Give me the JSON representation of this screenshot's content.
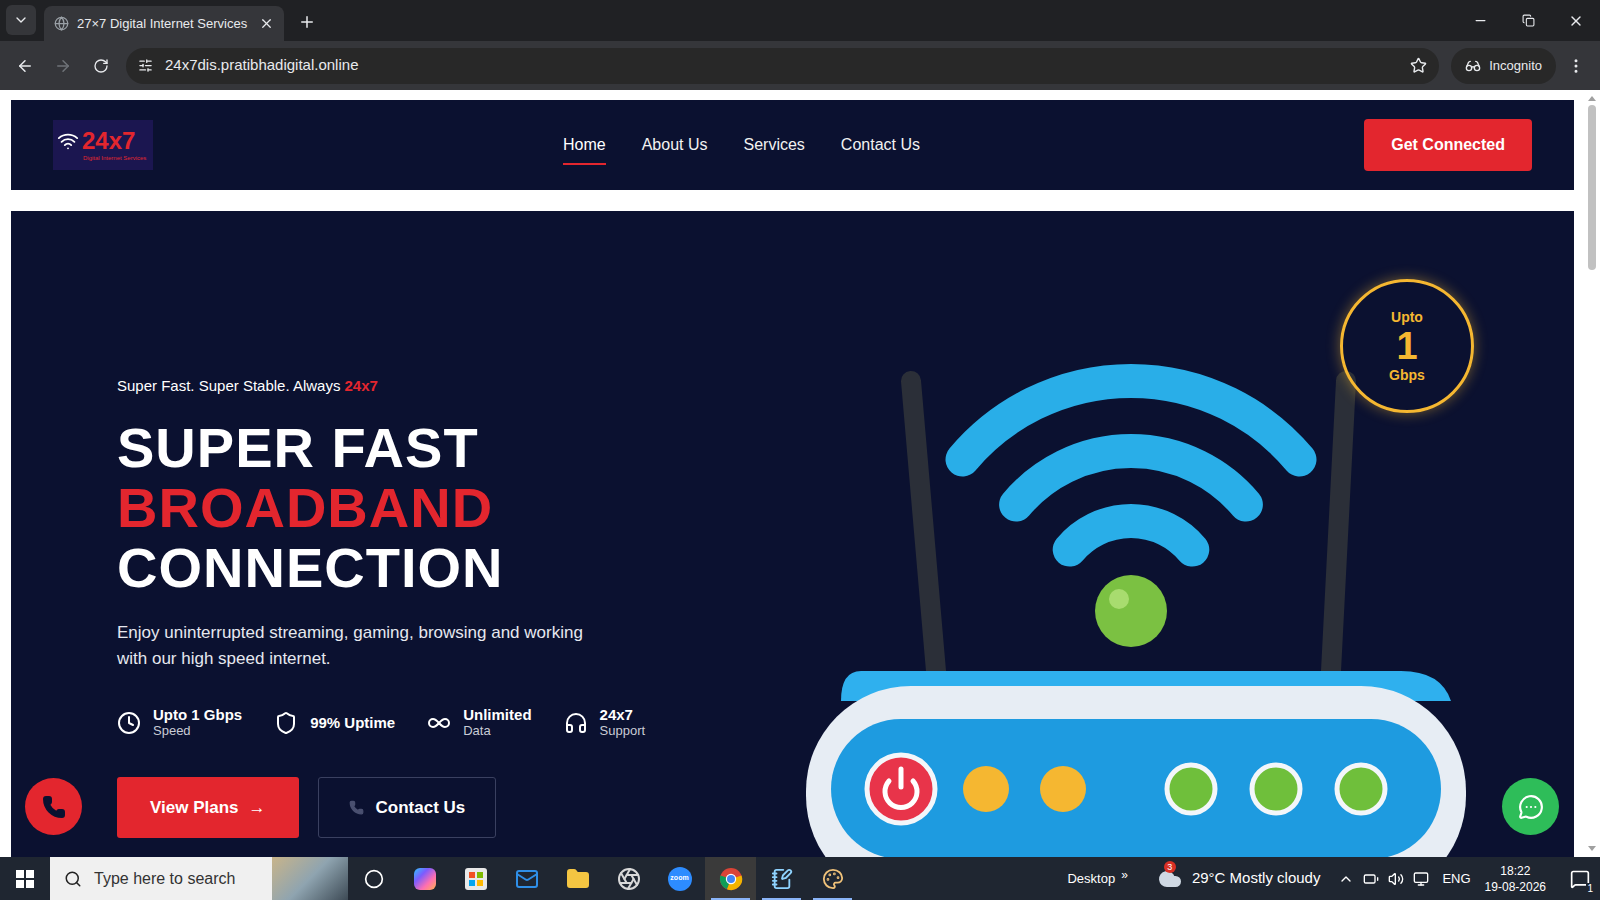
{
  "browser": {
    "tab_title": "27×7 Digital Internet Services",
    "url": "24x7dis.pratibhadigital.online",
    "incognito_label": "Incognito",
    "back_enabled": true,
    "forward_enabled": false
  },
  "nav": {
    "logo_text": "24x7",
    "logo_subtitle": "Digital Internet Services",
    "links": [
      {
        "label": "Home",
        "selected": true
      },
      {
        "label": "About Us",
        "selected": false
      },
      {
        "label": "Services",
        "selected": false
      },
      {
        "label": "Contact Us",
        "selected": false
      }
    ],
    "cta": "Get Connected"
  },
  "hero": {
    "tagline": "Super Fast. Super Stable. Always",
    "tagline_highlight": "24x7",
    "headline": [
      {
        "text": "SUPER FAST",
        "highlight": false
      },
      {
        "text": "BROADBAND",
        "highlight": true
      },
      {
        "text": "CONNECTION",
        "highlight": false
      }
    ],
    "description": "Enjoy uninterrupted streaming, gaming, browsing and working with our high speed internet.",
    "features": [
      {
        "kind": "speed",
        "title": "Upto 1 Gbps",
        "subtitle": "Speed"
      },
      {
        "kind": "uptime",
        "title": "99% Uptime"
      },
      {
        "kind": "data",
        "title": "Unlimited",
        "subtitle": "Data"
      },
      {
        "kind": "support",
        "title": "24x7",
        "subtitle": "Support"
      }
    ],
    "buttons": [
      {
        "kind": "primary",
        "label": "View Plans",
        "arrow": "→"
      },
      {
        "kind": "outline",
        "label": "Contact Us"
      }
    ],
    "badge": {
      "top": "Upto",
      "value": "1",
      "unit": "Gbps"
    }
  },
  "taskbar": {
    "search_placeholder": "Type here to search",
    "apps": [
      {
        "kind": "task-view",
        "active": false,
        "running": false
      },
      {
        "kind": "copilot",
        "active": false,
        "running": false
      },
      {
        "kind": "store",
        "active": false,
        "running": false
      },
      {
        "kind": "outlook",
        "active": false,
        "running": false
      },
      {
        "kind": "explorer",
        "active": false,
        "running": false
      },
      {
        "kind": "obs",
        "active": false,
        "running": false
      },
      {
        "kind": "zoom",
        "label": "zoom",
        "active": false,
        "running": false
      },
      {
        "kind": "chrome",
        "active": true,
        "running": true
      },
      {
        "kind": "notepad",
        "active": false,
        "running": true
      },
      {
        "kind": "paint",
        "active": false,
        "running": true
      }
    ],
    "desktop": "Desktop",
    "desktop_chevron": "»",
    "weather_badge": "3",
    "weather": "29°C Mostly cloudy",
    "language": "ENG",
    "time": "18:22",
    "date": "19-08-2026",
    "notifications": "1"
  }
}
